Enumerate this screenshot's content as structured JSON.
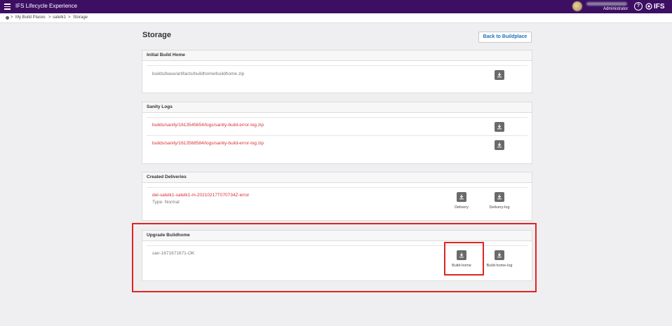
{
  "app": {
    "title": "IFS Lifecycle Experience",
    "user_role": "Administrator",
    "logo_text": "IFS"
  },
  "breadcrumb": {
    "items": [
      "My Build Places",
      "satelk1",
      "Storage"
    ],
    "separator": ">"
  },
  "page": {
    "title": "Storage",
    "back_button": "Back to Buildplace"
  },
  "panels": {
    "initial_build_home": {
      "title": "Initial Build Home",
      "rows": [
        {
          "path": "builds/base/artifacts/buildhome/buildhome.zip"
        }
      ]
    },
    "sanity_logs": {
      "title": "Sanity Logs",
      "rows": [
        {
          "path": "builds/sanity/1613545654/logs/sanity-build-error-log.zip"
        },
        {
          "path": "builds/sanity/1613568584/logs/sanity-build-error-log.zip"
        }
      ]
    },
    "created_deliveries": {
      "title": "Created Deliveries",
      "rows": [
        {
          "path": "del-satelk1-satelk1-m-20210217T070734Z-error",
          "type": "Type: Normal",
          "downloads": [
            "Delivery",
            "Delivery-log"
          ]
        }
      ]
    },
    "upgrade_buildhome": {
      "title": "Upgrade Buildhome",
      "rows": [
        {
          "path": "san-1671671671-OK",
          "downloads": [
            "Build-home",
            "Build-home-log"
          ]
        }
      ]
    }
  },
  "icons": {
    "download": "download-icon",
    "menu": "hamburger-menu-icon",
    "help": "help-icon"
  },
  "colors": {
    "topbar": "#3d0f63",
    "link_red": "#d93030",
    "highlight": "#e02424",
    "button_blue": "#1a73b8"
  }
}
